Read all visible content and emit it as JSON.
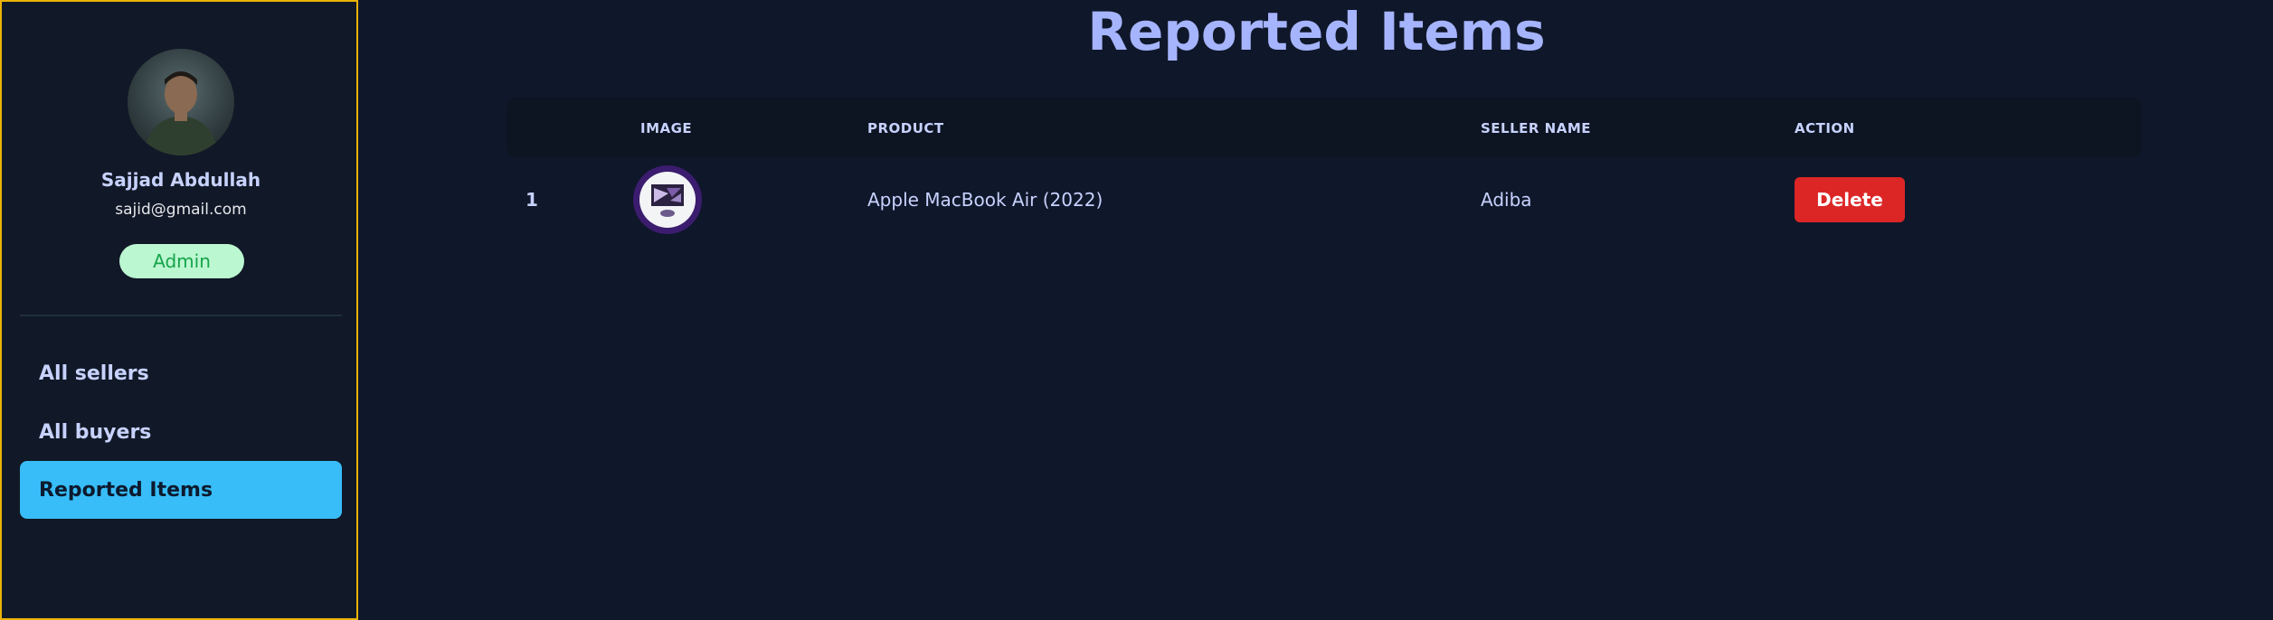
{
  "sidebar": {
    "user": {
      "name": "Sajjad Abdullah",
      "email": "sajid@gmail.com",
      "role": "Admin"
    },
    "nav": [
      {
        "label": "All sellers",
        "active": false
      },
      {
        "label": "All buyers",
        "active": false
      },
      {
        "label": "Reported Items",
        "active": true
      }
    ]
  },
  "main": {
    "title": "Reported Items",
    "table": {
      "columns": [
        "",
        "IMAGE",
        "PRODUCT",
        "SELLER NAME",
        "ACTION"
      ],
      "rows": [
        {
          "index": "1",
          "product": "Apple MacBook Air (2022)",
          "seller": "Adiba",
          "action_label": "Delete"
        }
      ]
    }
  },
  "colors": {
    "background": "#0f172a",
    "sidebar_border": "#eab308",
    "active_nav": "#38bdf8",
    "badge_bg": "#bbf7d0",
    "delete": "#dc2626",
    "title": "#a5b4fc"
  }
}
